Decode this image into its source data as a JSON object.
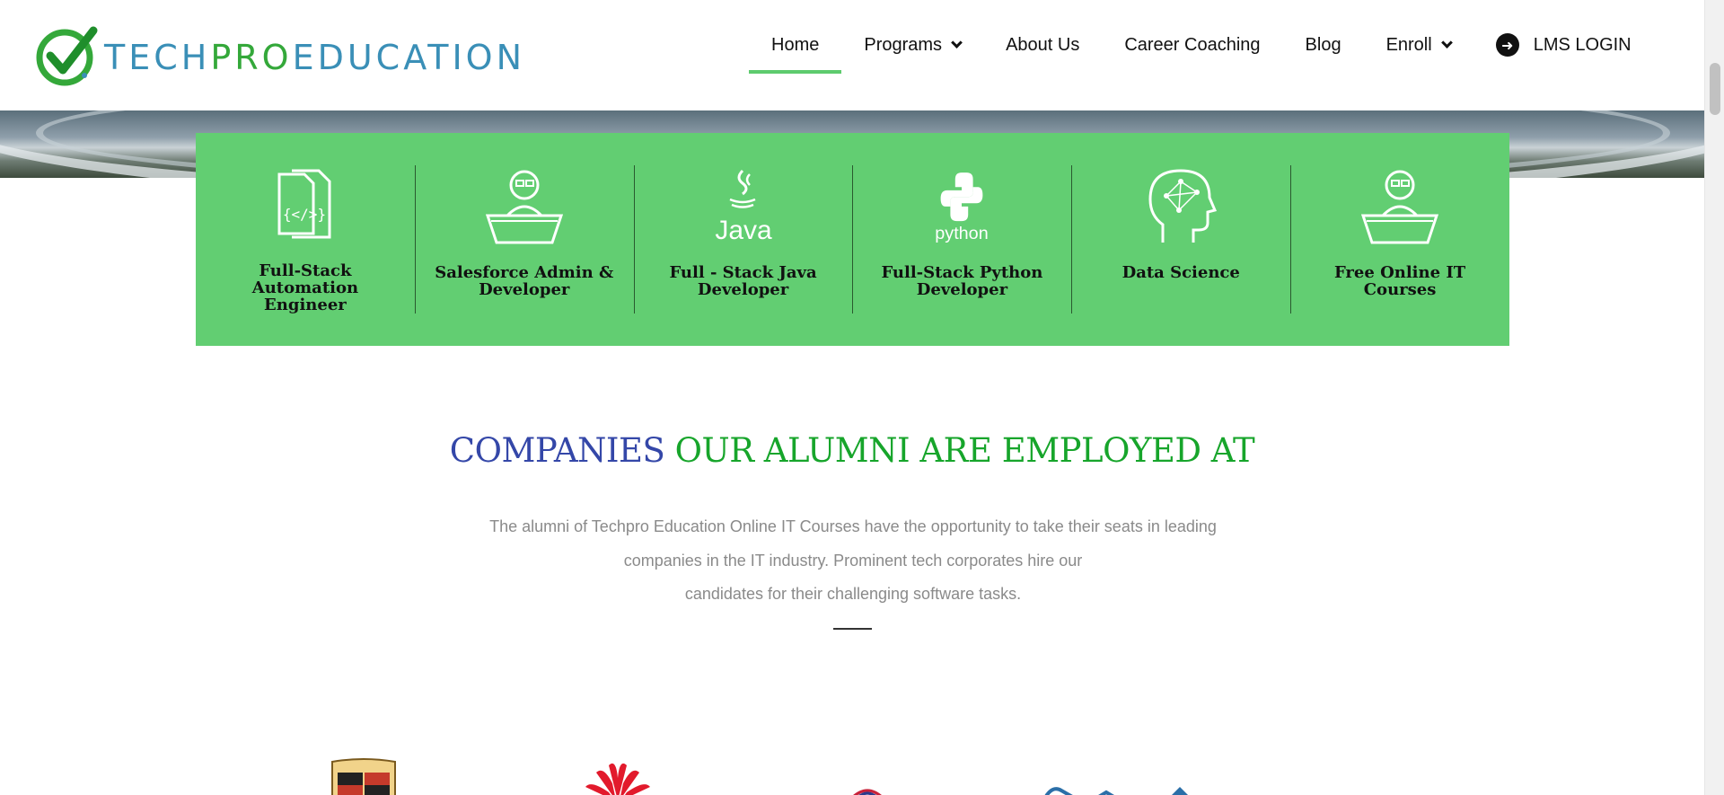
{
  "brand": {
    "wordmark_part1": "TECH",
    "wordmark_part2": "PRO",
    "wordmark_part3": "EDUCATION",
    "colors": {
      "green": "#34a83a",
      "blue": "#3a8fb7"
    }
  },
  "nav": {
    "items": [
      {
        "label": "Home",
        "active": true,
        "dropdown": false
      },
      {
        "label": "Programs",
        "active": false,
        "dropdown": true
      },
      {
        "label": "About Us",
        "active": false,
        "dropdown": false
      },
      {
        "label": "Career Coaching",
        "active": false,
        "dropdown": false
      },
      {
        "label": "Blog",
        "active": false,
        "dropdown": false
      },
      {
        "label": "Enroll",
        "active": false,
        "dropdown": true
      }
    ],
    "login_label": "LMS LOGIN",
    "login_icon": "arrow-circle-right-icon",
    "active_color": "#5ecb6e"
  },
  "programs": {
    "background": "#62ce72",
    "items": [
      {
        "label": "Full-Stack Automation Engineer",
        "icon": "code-document-icon"
      },
      {
        "label": "Salesforce Admin & Developer",
        "icon": "laptop-user-icon"
      },
      {
        "label": "Full - Stack Java Developer",
        "icon": "java-logo-icon"
      },
      {
        "label": "Full-Stack Python Developer",
        "icon": "python-logo-icon"
      },
      {
        "label": "Data Science",
        "icon": "brain-network-icon"
      },
      {
        "label": "Free Online IT Courses",
        "icon": "laptop-user-icon"
      }
    ],
    "java_text": "Java",
    "python_text": "python"
  },
  "companies": {
    "title_part1": "COMPANIES",
    "title_part2": "OUR ALUMNI ARE EMPLOYED AT",
    "description_line1": "The alumni of Techpro Education Online IT Courses have the opportunity to take their seats in leading",
    "description_line2": "companies in the IT industry. Prominent tech corporates hire our",
    "description_line3": "candidates for their challenging software tasks.",
    "logos": [
      "porsche-logo",
      "huawei-logo",
      "flag-logo",
      "swoosh-logo"
    ]
  }
}
